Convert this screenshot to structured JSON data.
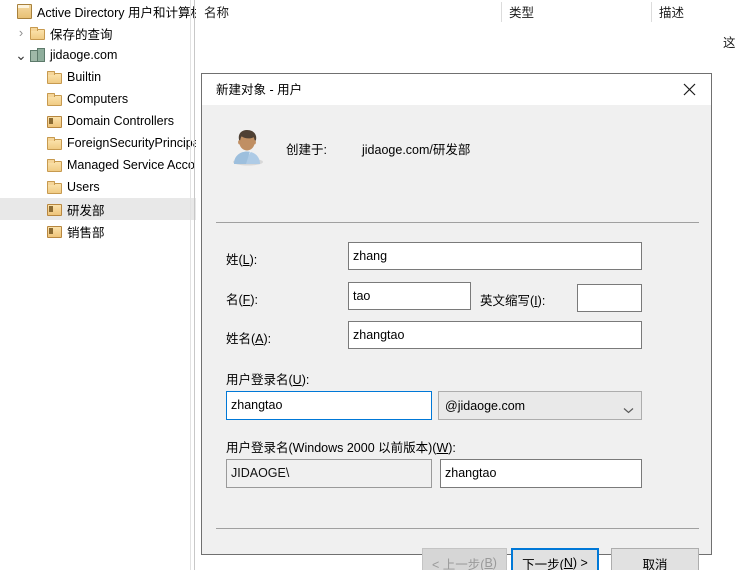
{
  "window": {
    "tree": {
      "items": [
        {
          "label": "Active Directory 用户和计算机",
          "icon": "console-icon",
          "indent": 0,
          "expander": "",
          "selected": false
        },
        {
          "label": "保存的查询",
          "icon": "folder-icon",
          "indent": 1,
          "expander": "collapsed",
          "selected": false
        },
        {
          "label": "jidaoge.com",
          "icon": "domain-icon",
          "indent": 1,
          "expander": "expanded",
          "selected": false
        },
        {
          "label": "Builtin",
          "icon": "folder-icon",
          "indent": 2,
          "expander": "",
          "selected": false
        },
        {
          "label": "Computers",
          "icon": "folder-icon",
          "indent": 2,
          "expander": "",
          "selected": false
        },
        {
          "label": "Domain Controllers",
          "icon": "ou-icon",
          "indent": 2,
          "expander": "",
          "selected": false
        },
        {
          "label": "ForeignSecurityPrincipa",
          "icon": "folder-icon",
          "indent": 2,
          "expander": "",
          "selected": false
        },
        {
          "label": "Managed Service Acco",
          "icon": "folder-icon",
          "indent": 2,
          "expander": "",
          "selected": false
        },
        {
          "label": "Users",
          "icon": "folder-icon",
          "indent": 2,
          "expander": "",
          "selected": false
        },
        {
          "label": "研发部",
          "icon": "ou-icon",
          "indent": 2,
          "expander": "",
          "selected": true
        },
        {
          "label": "销售部",
          "icon": "ou-icon",
          "indent": 2,
          "expander": "",
          "selected": false
        }
      ]
    },
    "list": {
      "columns": [
        {
          "label": "名称"
        },
        {
          "label": "类型"
        },
        {
          "label": "描述"
        }
      ],
      "partial_cell": "这"
    }
  },
  "dialog": {
    "title": "新建对象 - 用户",
    "close_icon": "close-icon",
    "avatar_icon": "user-avatar-icon",
    "created_in_label": "创建于:",
    "created_in_value": "jidaoge.com/研发部",
    "fields": {
      "last_name": {
        "label": "姓(L):",
        "label_text": "姓(",
        "accel": "L",
        "label_tail": "):",
        "value": "zhang"
      },
      "first_name": {
        "label": "名(F):",
        "label_text": "名(",
        "accel": "F",
        "label_tail": "):",
        "value": "tao"
      },
      "initials": {
        "label": "英文缩写(I):",
        "label_text": "英文缩写(",
        "accel": "I",
        "label_tail": "):",
        "value": ""
      },
      "full_name": {
        "label": "姓名(A):",
        "label_text": "姓名(",
        "accel": "A",
        "label_tail": "):",
        "value": "zhangtao"
      },
      "user_logon_name": {
        "label": "用户登录名(U):",
        "label_text": "用户登录名(",
        "accel": "U",
        "label_tail": "):",
        "value": "zhangtao",
        "suffix_selected": "@jidaoge.com",
        "suffix_icon": "chevron-down-icon"
      },
      "pre2000_logon_name": {
        "label": "用户登录名(Windows 2000 以前版本)(W):",
        "label_text": "用户登录名(Windows 2000 以前版本)(",
        "accel": "W",
        "label_tail": "):",
        "domain_prefix": "JIDAOGE\\",
        "value": "zhangtao"
      }
    },
    "buttons": {
      "back": {
        "pre": "< 上一步(",
        "accel": "B",
        "post": ")",
        "disabled": true
      },
      "next": {
        "pre": "下一步(",
        "accel": "N",
        "post": ") >",
        "default": true
      },
      "cancel": {
        "label": "取消"
      }
    }
  },
  "colors": {
    "accent": "#0078d7",
    "dialog_bg": "#f0f0f0",
    "selection": "#e8e8e8"
  }
}
